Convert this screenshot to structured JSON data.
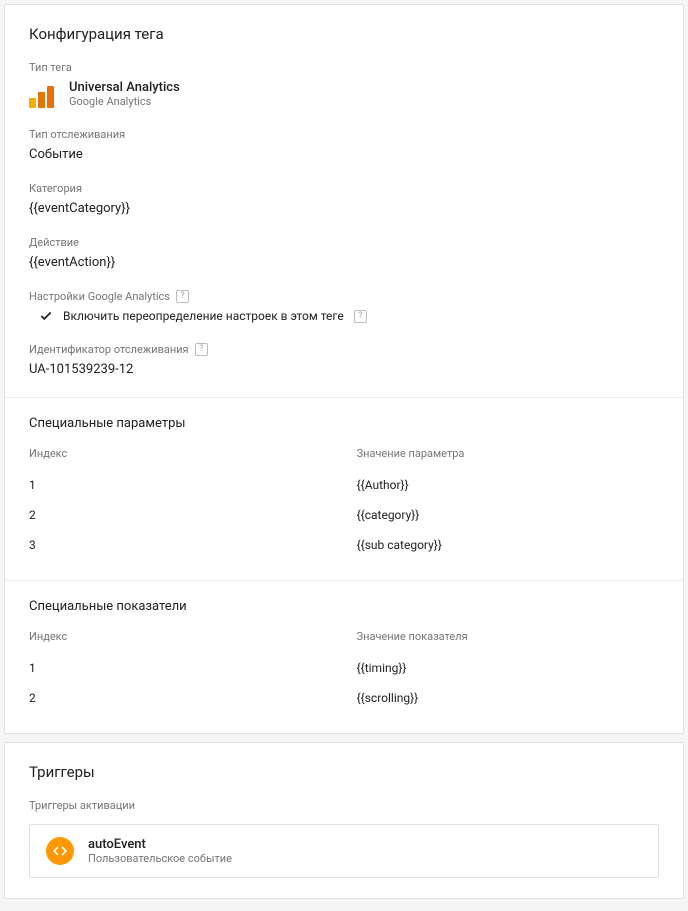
{
  "tagConfig": {
    "title": "Конфигурация тега",
    "tagTypeLabel": "Тип тега",
    "tagType": {
      "name": "Universal Analytics",
      "vendor": "Google Analytics"
    },
    "trackingTypeLabel": "Тип отслеживания",
    "trackingType": "Событие",
    "categoryLabel": "Категория",
    "category": "{{eventCategory}}",
    "actionLabel": "Действие",
    "action": "{{eventAction}}",
    "gaSettingsLabel": "Настройки Google Analytics",
    "overrideLabel": "Включить переопределение настроек в этом теге",
    "trackingIdLabel": "Идентификатор отслеживания",
    "trackingId": "UA-101539239-12",
    "customDimensions": {
      "title": "Специальные параметры",
      "indexHeader": "Индекс",
      "valueHeader": "Значение параметра",
      "rows": [
        {
          "index": "1",
          "value": "{{Author}}"
        },
        {
          "index": "2",
          "value": "{{category}}"
        },
        {
          "index": "3",
          "value": "{{sub category}}"
        }
      ]
    },
    "customMetrics": {
      "title": "Специальные показатели",
      "indexHeader": "Индекс",
      "valueHeader": "Значение показателя",
      "rows": [
        {
          "index": "1",
          "value": "{{timing}}"
        },
        {
          "index": "2",
          "value": "{{scrolling}}"
        }
      ]
    }
  },
  "triggers": {
    "title": "Триггеры",
    "activationLabel": "Триггеры активации",
    "items": [
      {
        "name": "autoEvent",
        "type": "Пользовательское событие"
      }
    ]
  }
}
